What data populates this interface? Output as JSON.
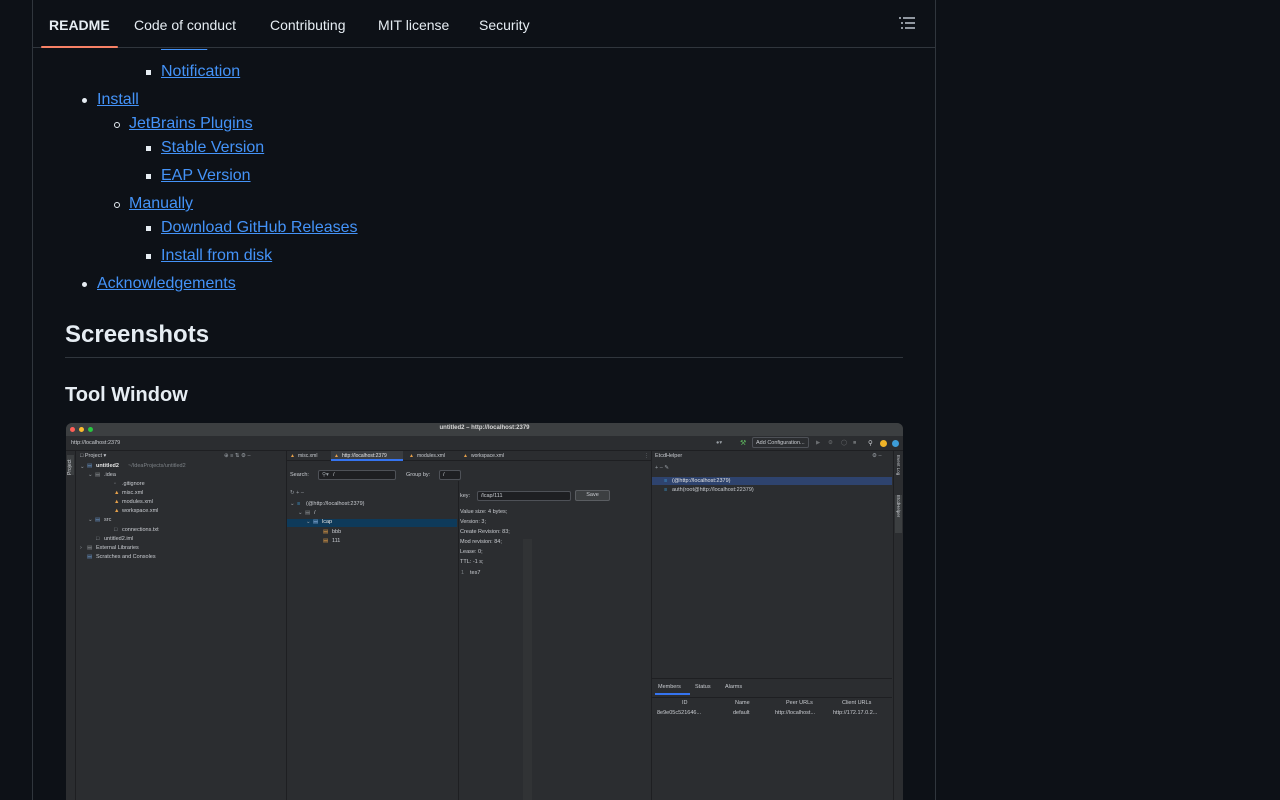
{
  "tabs": [
    {
      "label": "README",
      "active": true
    },
    {
      "label": "Code of conduct",
      "active": false
    },
    {
      "label": "Contributing",
      "active": false
    },
    {
      "label": "MIT license",
      "active": false
    },
    {
      "label": "Security",
      "active": false
    }
  ],
  "toc": {
    "delete": "Delete",
    "notification": "Notification",
    "install": "Install",
    "jetbrains_plugins": "JetBrains Plugins",
    "stable_version": "Stable Version",
    "eap_version": "EAP Version",
    "manually": "Manually",
    "download_releases": "Download GitHub Releases",
    "install_from_disk": "Install from disk",
    "acknowledgements": "Acknowledgements"
  },
  "headings": {
    "screenshots": "Screenshots",
    "tool_window": "Tool Window"
  },
  "colors": {
    "background": "#0d1117",
    "link": "#4493f8",
    "active_tab_underline": "#f78166",
    "border": "#30363d"
  },
  "ide": {
    "window_title": "untitled2 – http://localhost:2379",
    "nav_path": "http://localhost:2379",
    "add_configuration": "Add Configuration...",
    "project_label": "Project",
    "side_tab_project": "Project",
    "tree": {
      "root": "untitled2",
      "root_path": "~/IdeaProjects/untitled2",
      "idea": ".idea",
      "gitignore": ".gitignore",
      "misc": "misc.xml",
      "modules": "modules.xml",
      "workspace": "workspace.xml",
      "src": "src",
      "connections": "connections.txt",
      "iml": "untitled2.iml",
      "external": "External Libraries",
      "scratches": "Scratches and Consoles"
    },
    "editor_tabs": [
      "misc.xml",
      "http://localhost:2379",
      "modules.xml",
      "workspace.xml"
    ],
    "search_label": "Search:",
    "search_value": "/",
    "groupby_label": "Group by:",
    "groupby_value": "/",
    "kv_tree": {
      "conn": "(@http://localhost:2379)",
      "slash": "/",
      "folder": "lcap",
      "bbb": "bbb",
      "v111": "111"
    },
    "key_label": "key:",
    "key_value": "/lcap/111",
    "save": "Save",
    "details": [
      "Value size: 4 bytes;",
      "Version: 3;",
      "Create Revision: 83;",
      "Mod revision: 84;",
      "Lease: 0;",
      "TTL: -1 s;"
    ],
    "line_no": "1",
    "line_value": "tes7",
    "etcd_title": "EtcdHelper",
    "etcd_conn1": "(@http://localhost:2379)",
    "etcd_conn2": "auth(root@http://localhost:22379)",
    "right_strip_1": "Event Log",
    "right_strip_2": "EtcdHelper",
    "bottom_tabs": [
      "Members",
      "Status",
      "Alarms"
    ],
    "table_headers": [
      "ID",
      "Name",
      "Peer URLs",
      "Client URLs"
    ],
    "table_row": [
      "8e9e05c521646...",
      "default",
      "http://localhost...",
      "http://172.17.0.2..."
    ]
  }
}
